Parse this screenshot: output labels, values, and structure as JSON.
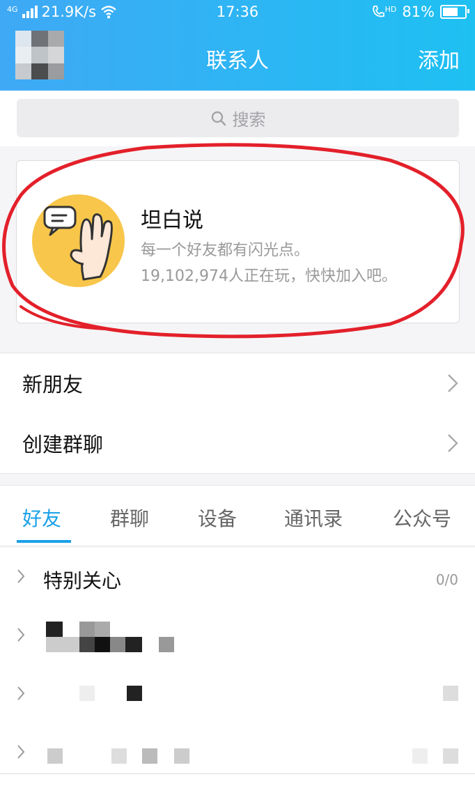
{
  "status_bar": {
    "network_type": "4G",
    "speed": "21.9K/s",
    "time": "17:36",
    "hd": "HD",
    "battery": "81%",
    "battery_level": 0.81
  },
  "header": {
    "title": "联系人",
    "add_label": "添加"
  },
  "search": {
    "placeholder": "搜索"
  },
  "promo_card": {
    "name": "坦白说",
    "tagline": "每一个好友都有闪光点。",
    "players": "19,102,974人正在玩，快快加入吧。",
    "colors": {
      "icon_bg": "#f7c64a",
      "annotation": "#e3202a"
    }
  },
  "menu": {
    "items": [
      {
        "label": "新朋友"
      },
      {
        "label": "创建群聊"
      }
    ]
  },
  "tabs": {
    "items": [
      {
        "label": "好友",
        "active": true
      },
      {
        "label": "群聊",
        "active": false
      },
      {
        "label": "设备",
        "active": false
      },
      {
        "label": "通讯录",
        "active": false
      },
      {
        "label": "公众号",
        "active": false
      }
    ],
    "accent": "#1aa1e8"
  },
  "friend_groups": [
    {
      "name": "特别关心",
      "count": "0/0"
    }
  ]
}
